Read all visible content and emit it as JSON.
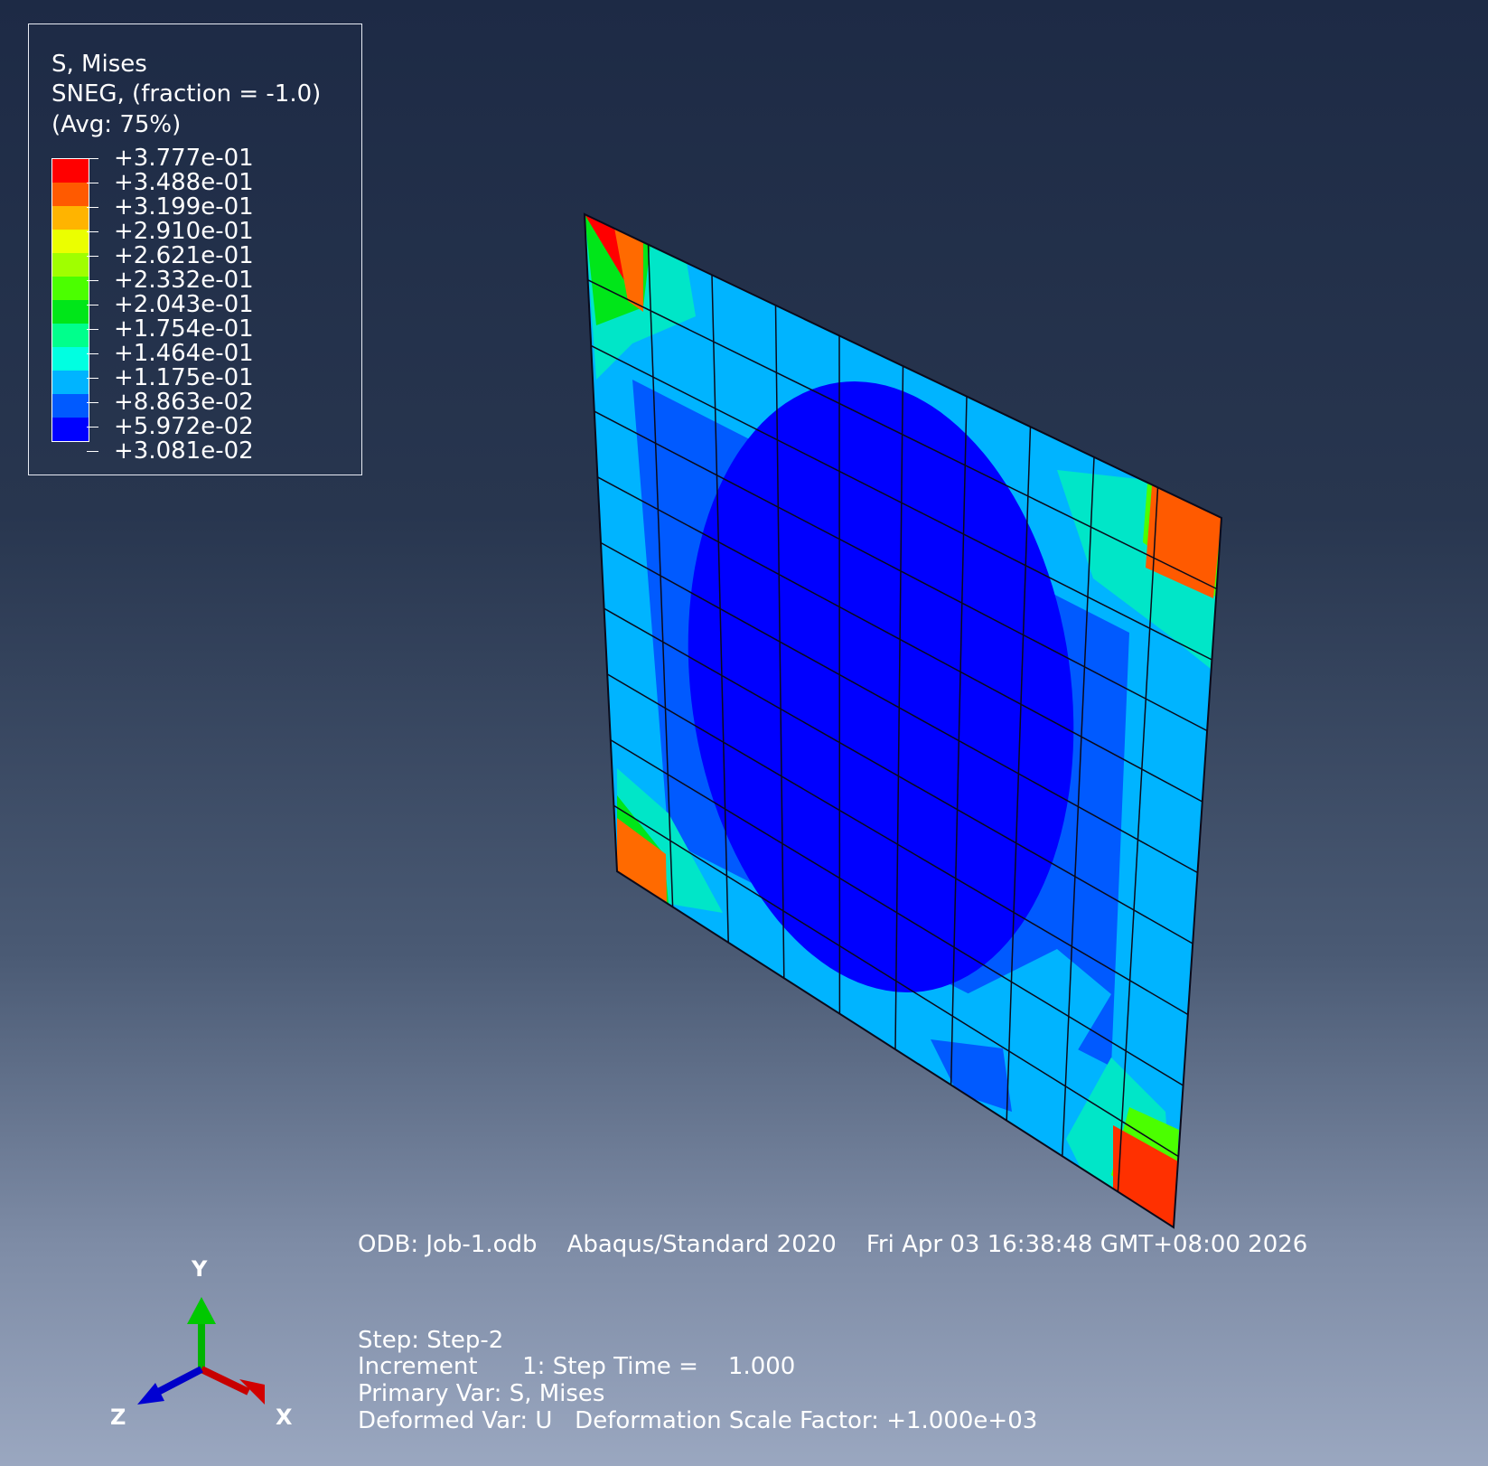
{
  "legend": {
    "title": "S, Mises",
    "subtitle": "SNEG, (fraction = -1.0)",
    "averaging": "(Avg: 75%)",
    "values": [
      "+3.777e-01",
      "+3.488e-01",
      "+3.199e-01",
      "+2.910e-01",
      "+2.621e-01",
      "+2.332e-01",
      "+2.043e-01",
      "+1.754e-01",
      "+1.464e-01",
      "+1.175e-01",
      "+8.863e-02",
      "+5.972e-02",
      "+3.081e-02"
    ],
    "colors": [
      "#ff0000",
      "#ff5a00",
      "#ffb400",
      "#ebff00",
      "#a0ff00",
      "#4bff00",
      "#00e619",
      "#00ff8c",
      "#00ffe1",
      "#00b4ff",
      "#005aff",
      "#0000ff"
    ]
  },
  "info": {
    "odb": "ODB: Job-1.odb    Abaqus/Standard 2020    Fri Apr 03 16:38:48 GMT+08:00 2026",
    "step": "Step: Step-2",
    "increment": "Increment      1: Step Time =    1.000",
    "primary_var": "Primary Var: S, Mises",
    "deformed_var": "Deformed Var: U   Deformation Scale Factor: +1.000e+03"
  },
  "triad": {
    "y": "Y",
    "z": "Z",
    "x": "X"
  }
}
